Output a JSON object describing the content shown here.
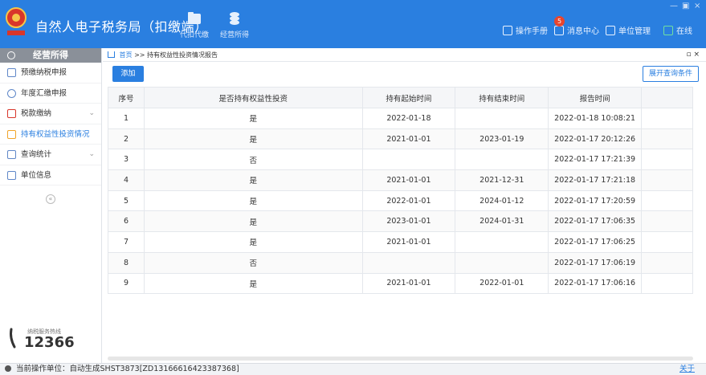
{
  "header": {
    "title": "自然人电子税务局（扣缴端）",
    "modules": [
      {
        "label": "代扣代缴",
        "icon": "folder-icon"
      },
      {
        "label": "经营所得",
        "icon": "coins-icon"
      }
    ],
    "right_items": [
      {
        "label": "操作手册",
        "icon": "manual-icon"
      },
      {
        "label": "消息中心",
        "icon": "message-icon"
      },
      {
        "label": "单位管理",
        "icon": "building-icon"
      },
      {
        "label": "在线",
        "icon": "online-icon"
      }
    ],
    "message_badge": "5",
    "accent": "#2a7fe0"
  },
  "sidebar": {
    "title": "经营所得",
    "items": [
      {
        "label": "预缴纳税申报",
        "icon": "declare-icon"
      },
      {
        "label": "年度汇缴申报",
        "icon": "annual-icon"
      },
      {
        "label": "税款缴纳",
        "icon": "payment-icon"
      },
      {
        "label": "持有权益性投资情况",
        "icon": "investment-icon"
      },
      {
        "label": "查询统计",
        "icon": "query-icon"
      },
      {
        "label": "单位信息",
        "icon": "unit-info-icon"
      }
    ],
    "collapse_glyph": "«",
    "hotline": {
      "label": "纳税服务热线",
      "number": "12366"
    }
  },
  "breadcrumb": {
    "home": "首页",
    "separator": ">>",
    "current": "持有权益性投资情况报告",
    "controls": "▫ ×"
  },
  "toolbar": {
    "add": "添加",
    "expand": "展开查询条件"
  },
  "table": {
    "columns": [
      "序号",
      "是否持有权益性投资",
      "持有起始时间",
      "持有结束时间",
      "报告时间"
    ],
    "rows": [
      [
        "1",
        "是",
        "2022-01-18",
        "",
        "2022-01-18 10:08:21"
      ],
      [
        "2",
        "是",
        "2021-01-01",
        "2023-01-19",
        "2022-01-17 20:12:26"
      ],
      [
        "3",
        "否",
        "",
        "",
        "2022-01-17 17:21:39"
      ],
      [
        "4",
        "是",
        "2021-01-01",
        "2021-12-31",
        "2022-01-17 17:21:18"
      ],
      [
        "5",
        "是",
        "2022-01-01",
        "2024-01-12",
        "2022-01-17 17:20:59"
      ],
      [
        "6",
        "是",
        "2023-01-01",
        "2024-01-31",
        "2022-01-17 17:06:35"
      ],
      [
        "7",
        "是",
        "2021-01-01",
        "",
        "2022-01-17 17:06:25"
      ],
      [
        "8",
        "否",
        "",
        "",
        "2022-01-17 17:06:19"
      ],
      [
        "9",
        "是",
        "2021-01-01",
        "2022-01-01",
        "2022-01-17 17:06:16"
      ]
    ]
  },
  "status": {
    "text": "当前操作单位：自动生成SHST3873[ZD13166616423387368]",
    "close": "关于"
  }
}
